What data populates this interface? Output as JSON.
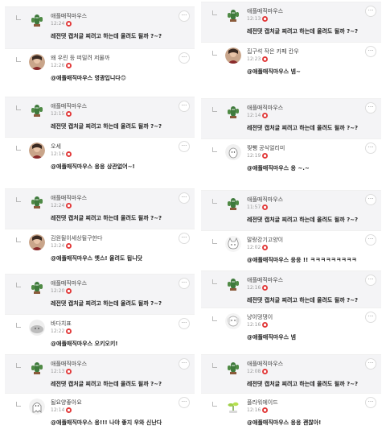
{
  "left_comments": [
    {
      "author": "애플매직마우스",
      "time": "12:24",
      "text": "레전댓 캡처글 찌려고 하는데 올려도 될까 ?~?",
      "avatar": "cactus-icon"
    },
    {
      "author": "왜 우린 등 떠밀려 저물까",
      "time": "12:26",
      "text": "@애플매직마우스 영광입니다😊",
      "avatar": "person-avatar"
    },
    {
      "author": "애플매직마우스",
      "time": "12:15",
      "text": "레전댓 캡처글 찌려고 하는데 올려도 될까 ?~?",
      "avatar": "cactus-icon"
    },
    {
      "author": "오세",
      "time": "12:16",
      "text": "@애플매직마우스 응응 상관없어~!",
      "avatar": "person-avatar"
    },
    {
      "author": "애플매직마우스",
      "time": "12:24",
      "text": "레전댓 캡처글 찌려고 하는데 올려도 될까 ?~?",
      "avatar": "cactus-icon"
    },
    {
      "author": "김원될이세상될구한다",
      "time": "12:24",
      "text": "@애플매직마우스 옛스! 올려도 됩니닷",
      "avatar": "person-avatar"
    },
    {
      "author": "애플매직마우스",
      "time": "12:20",
      "text": "레전댓 캡처글 찌려고 하는데 올려도 될까 ?~?",
      "avatar": "cactus-icon"
    },
    {
      "author": "바다치표",
      "time": "12:22",
      "text": "@애플매직마우스 오키오키!",
      "avatar": "seal-avatar"
    },
    {
      "author": "애플매직마우스",
      "time": "12:13",
      "text": "레전댓 캡처글 찌려고 하는데 올려도 될까 ?~?",
      "avatar": "cactus-icon"
    },
    {
      "author": "될요양좋아요",
      "time": "12:14",
      "text": "@애플매직마우스 응!!! 나야 좋지 우와 신난다",
      "avatar": "ghost-avatar"
    }
  ],
  "right_comments": [
    {
      "author": "애플매직마우스",
      "time": "12:13",
      "text": "레전댓 캡처글 찌려고 하는데 올려도 될까 ?~?",
      "avatar": "cactus-icon"
    },
    {
      "author": "집구석 작은 카페 칸우",
      "time": "12:23",
      "text": "@애플매직마우스 넴~",
      "avatar": "person-avatar"
    },
    {
      "author": "애플매직마우스",
      "time": "12:14",
      "text": "레전댓 캡처글 찌려고 하는데 올려도 될까 ?~?",
      "avatar": "cactus-icon"
    },
    {
      "author": "찢뺑 공식얼리미",
      "time": "12:19",
      "text": "@애플매직마우스 응 ~.~",
      "avatar": "blob-avatar"
    },
    {
      "author": "애플매직마우스",
      "time": "11:57",
      "text": "레전댓 캡처글 찌려고 하는데 올려도 될까 ?~?",
      "avatar": "cactus-icon"
    },
    {
      "author": "말랑강기고양이",
      "time": "12:02",
      "text": "@애플매직마우스 응응 !! ㅋㅋㅋㅋㅋㅋㅋㅋㅋ",
      "avatar": "cat-avatar"
    },
    {
      "author": "애플매직마우스",
      "time": "12:16",
      "text": "레전댓 캡처글 찌려고 하는데 올려도 될까 ?~?",
      "avatar": "cactus-icon"
    },
    {
      "author": "냥이댕댕이",
      "time": "12:16",
      "text": "@애플매직마우스 넴",
      "avatar": "dog-avatar"
    },
    {
      "author": "애플매직마우스",
      "time": "12:08",
      "text": "레전댓 캡처글 찌려고 하는데 올려도 될까 ?~?",
      "avatar": "cactus-icon"
    },
    {
      "author": "플라워에이드",
      "time": "12:16",
      "text": "@애플매직마우스 응응 괜찮아!",
      "avatar": "sprout-avatar"
    }
  ],
  "more_label": "···"
}
